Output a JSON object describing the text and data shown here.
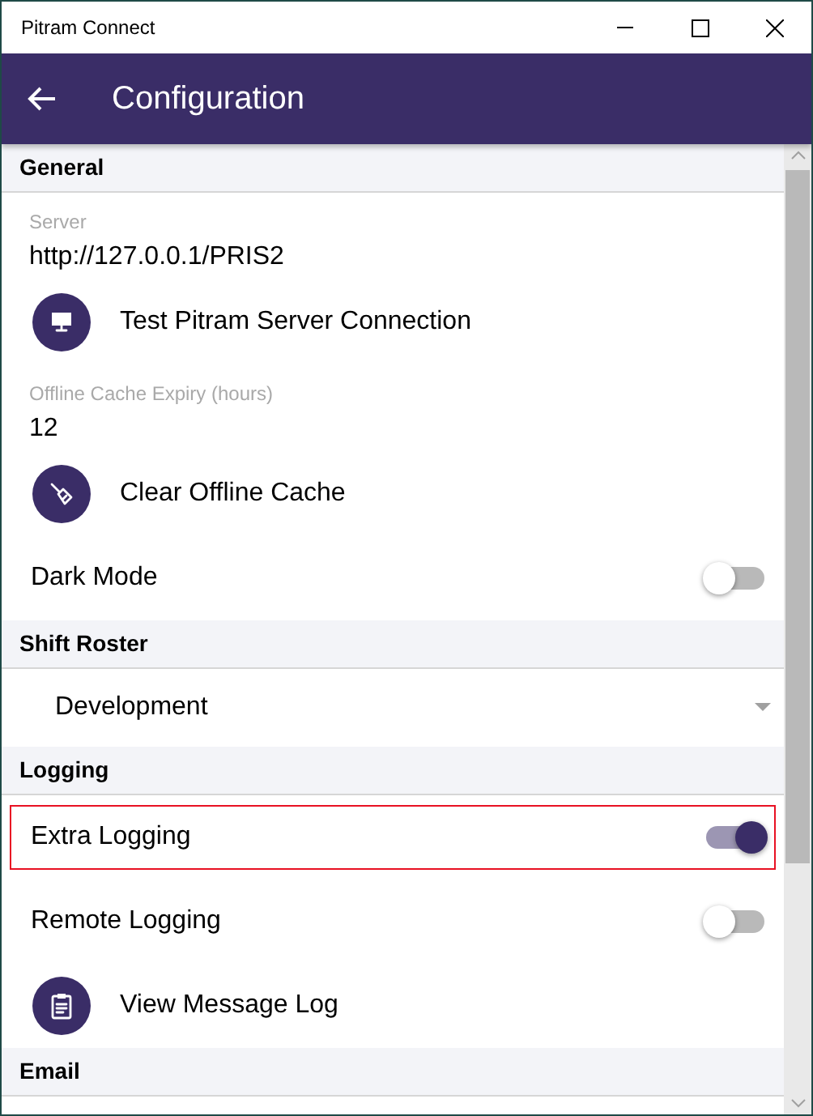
{
  "window": {
    "title": "Pitram Connect"
  },
  "header": {
    "title": "Configuration"
  },
  "sections": [
    {
      "title": "General",
      "items": [
        {
          "kind": "field",
          "label": "Server",
          "value": "http://127.0.0.1/PRIS2"
        },
        {
          "kind": "action",
          "label": "Test Pitram Server Connection"
        },
        {
          "kind": "field",
          "label": "Offline Cache Expiry (hours)",
          "value": "12"
        },
        {
          "kind": "action",
          "label": "Clear Offline Cache"
        },
        {
          "kind": "toggle",
          "label": "Dark Mode",
          "on": false,
          "focused": false
        }
      ]
    },
    {
      "title": "Shift Roster",
      "items": [
        {
          "kind": "picker",
          "value": "Development"
        }
      ]
    },
    {
      "title": "Logging",
      "items": [
        {
          "kind": "toggle",
          "label": "Extra Logging",
          "on": true,
          "focused": true
        },
        {
          "kind": "toggle",
          "label": "Remote Logging",
          "on": false,
          "focused": false
        },
        {
          "kind": "action",
          "label": "View Message Log"
        }
      ]
    },
    {
      "title": "Email"
    }
  ]
}
